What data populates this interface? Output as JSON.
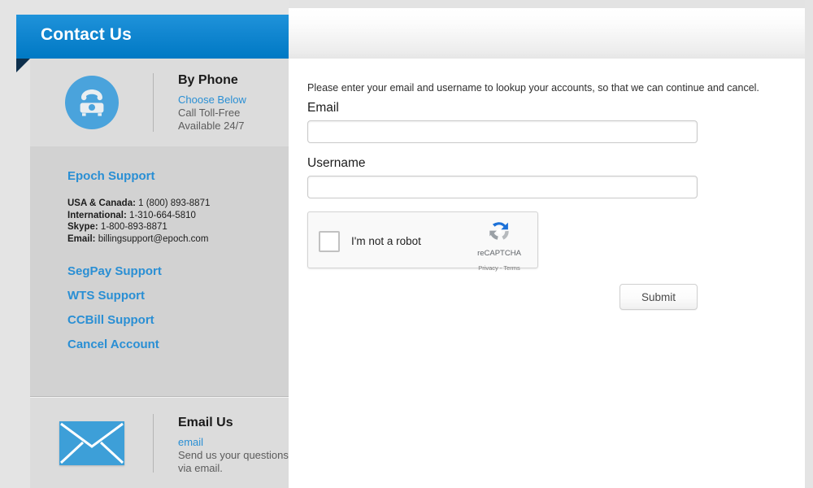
{
  "banner": {
    "title": "Contact Us"
  },
  "sidebar": {
    "phone": {
      "icon": "telephone-icon",
      "title": "By Phone",
      "link": "Choose Below",
      "line1": "Call Toll-Free",
      "line2": "Available 24/7"
    },
    "support": {
      "heading": "Epoch Support",
      "contacts": [
        {
          "label": "USA & Canada:",
          "value": "1 (800) 893-8871"
        },
        {
          "label": "International:",
          "value": "1-310-664-5810"
        },
        {
          "label": "Skype:",
          "value": "1-800-893-8871"
        },
        {
          "label": "Email:",
          "value": "billingsupport@epoch.com"
        }
      ],
      "links": [
        "SegPay Support",
        "WTS Support",
        "CCBill Support",
        "Cancel Account"
      ]
    },
    "email": {
      "icon": "envelope-icon",
      "title": "Email Us",
      "link": "email",
      "line1": "Send us your questions",
      "line2": "via email."
    }
  },
  "form": {
    "intro": "Please enter your email and username to lookup your accounts, so that we can continue and cancel.",
    "email": {
      "label": "Email",
      "value": "",
      "placeholder": ""
    },
    "username": {
      "label": "Username",
      "value": "",
      "placeholder": ""
    },
    "recaptcha": {
      "checkbox_label": "I'm not a robot",
      "brand": "reCAPTCHA",
      "legal": "Privacy - Terms"
    },
    "submit_label": "Submit"
  },
  "colors": {
    "banner_blue": "#0f86d0",
    "link_blue": "#2a8fd4",
    "icon_blue": "#4aa3dc",
    "fold_navy": "#0d2f4c",
    "page_bg": "#e4e4e4"
  }
}
